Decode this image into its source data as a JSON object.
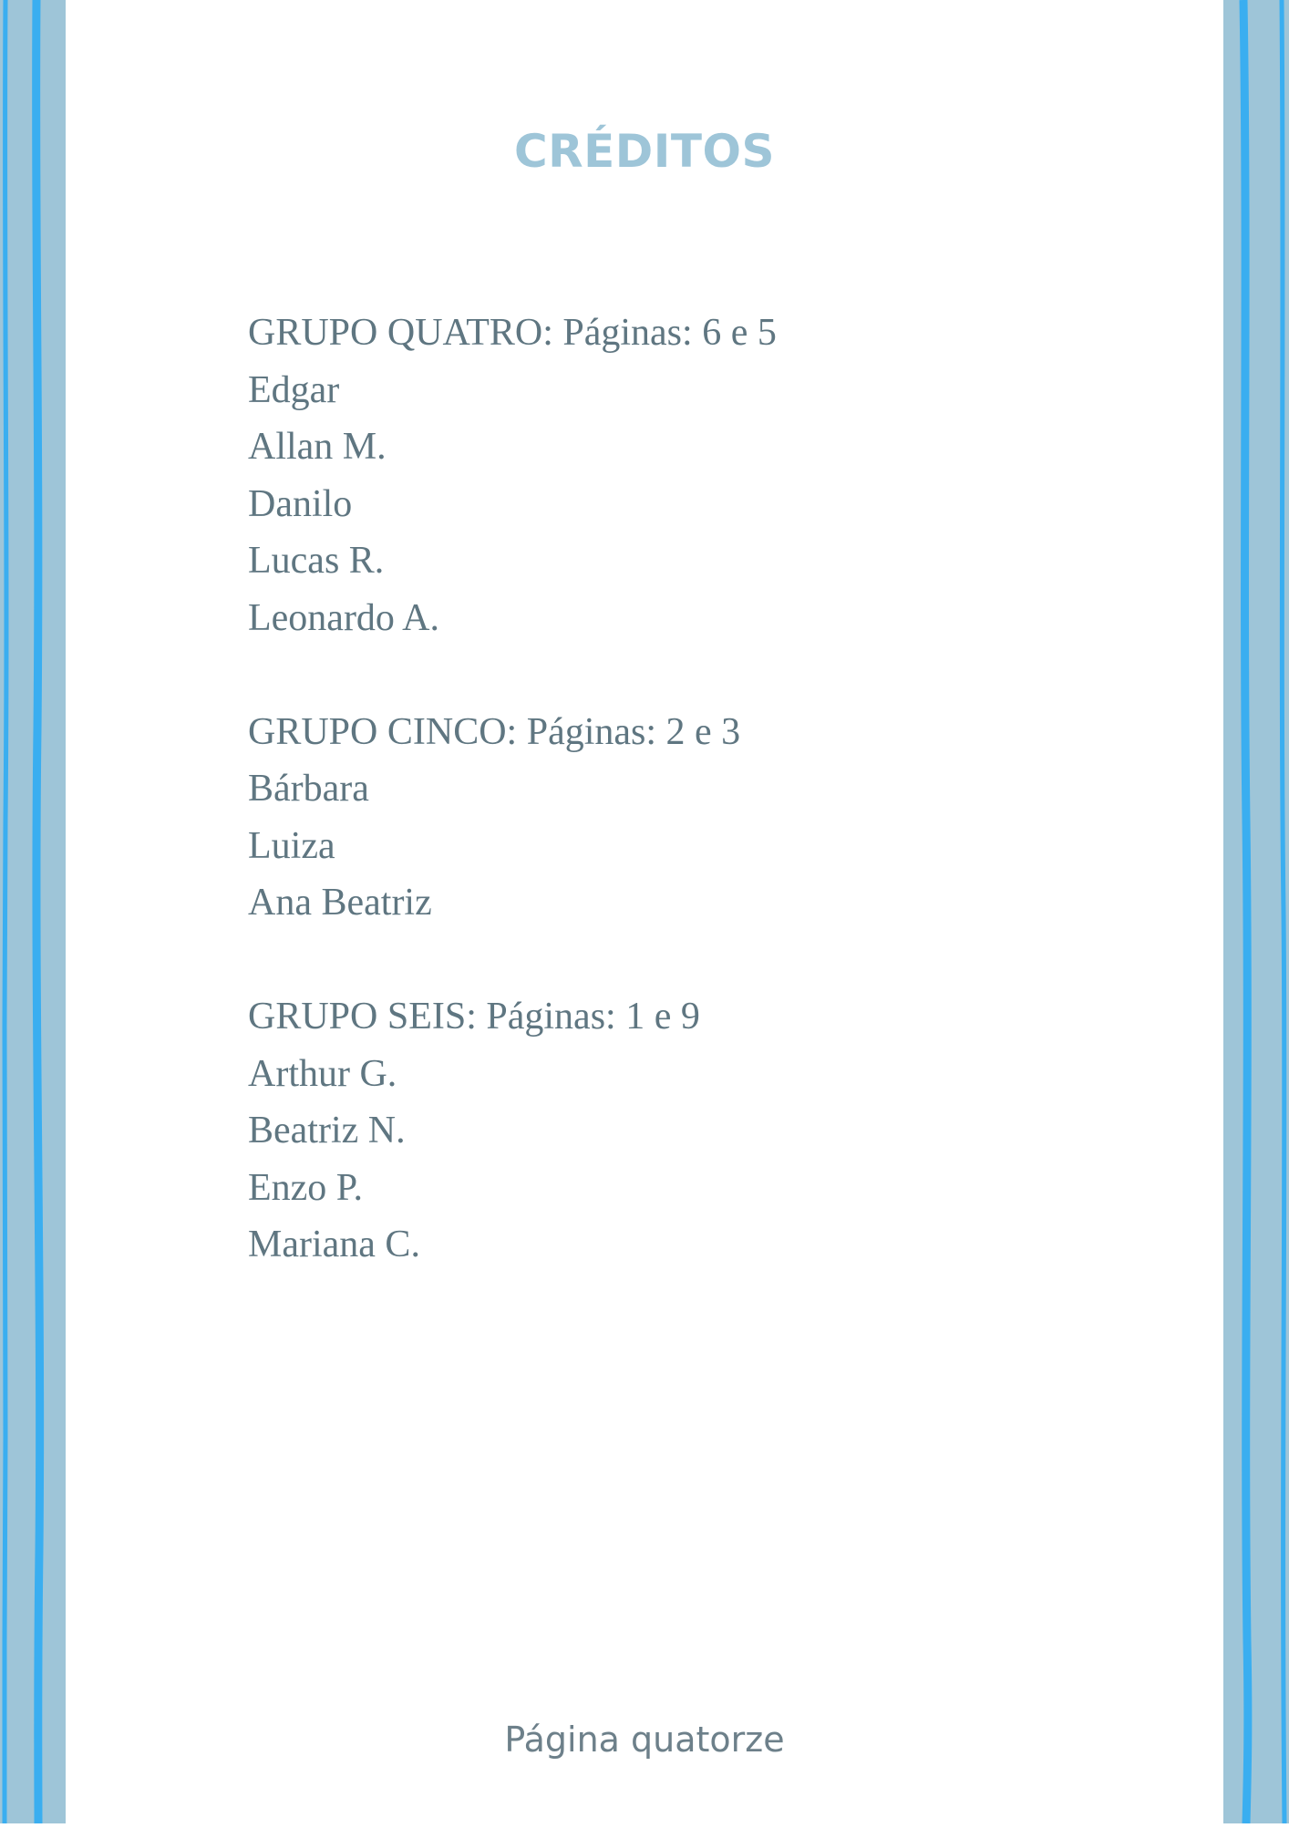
{
  "title": "CRÉDITOS",
  "groups": [
    {
      "heading": "GRUPO QUATRO: Páginas: 6 e 5",
      "members": [
        "Edgar",
        "Allan M.",
        "Danilo",
        "Lucas R.",
        "Leonardo A."
      ]
    },
    {
      "heading": "GRUPO CINCO: Páginas: 2 e 3",
      "members": [
        "Bárbara",
        "Luiza",
        "Ana Beatriz"
      ]
    },
    {
      "heading": "GRUPO SEIS: Páginas: 1 e 9",
      "members": [
        "Arthur G.",
        "Beatriz N.",
        "Enzo P.",
        "Mariana C."
      ]
    }
  ],
  "footer": "Página quatorze",
  "colors": {
    "title": "#9ec5d8",
    "body_text": "#5f7681",
    "footer_text": "#6d808a",
    "border_light": "#9ec5d8",
    "border_bright": "#3aaef0"
  }
}
